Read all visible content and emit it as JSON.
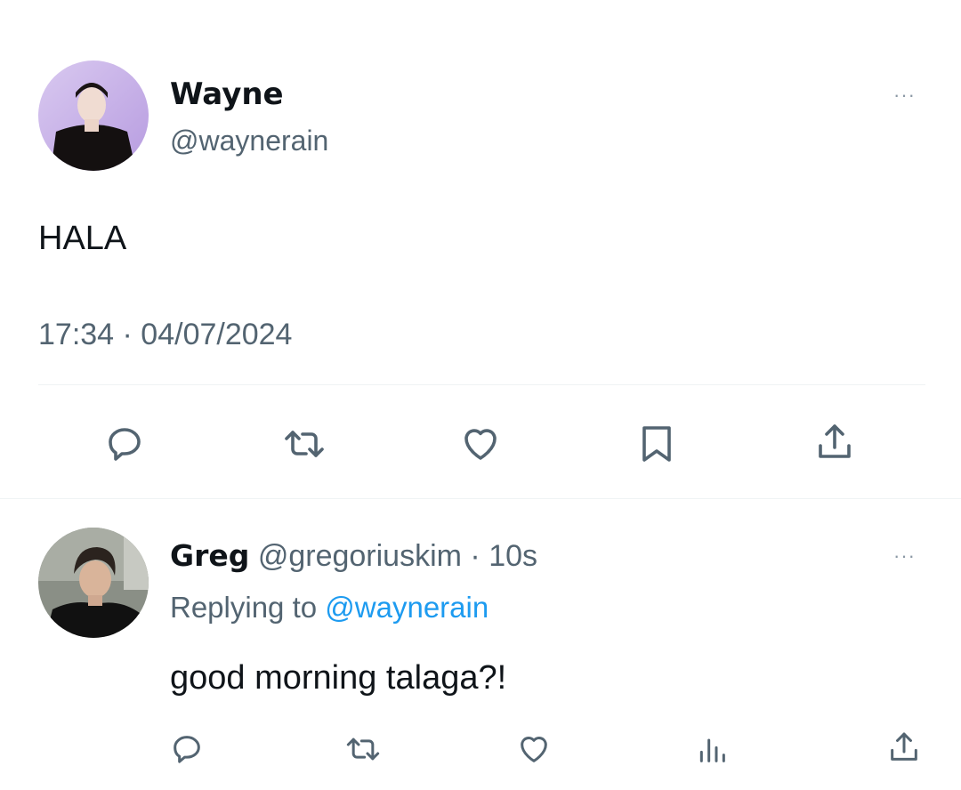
{
  "main_tweet": {
    "author": {
      "name": "Wayne",
      "handle": "@waynerain"
    },
    "text": "HALA",
    "timestamp": "17:34 · 04/07/2024",
    "more_label": "···",
    "actions": [
      "reply-icon",
      "retweet-icon",
      "like-icon",
      "bookmark-icon",
      "share-icon"
    ]
  },
  "reply": {
    "author": {
      "name": "Greg",
      "handle": "@gregoriuskim",
      "time": "· 10s"
    },
    "replying_to_label": "Replying to",
    "replying_to_handle": "@waynerain",
    "text": "good morning talaga?!",
    "more_label": "···",
    "actions": [
      "reply-icon",
      "retweet-icon",
      "like-icon",
      "views-icon",
      "share-icon"
    ]
  },
  "colors": {
    "text": "#0f1419",
    "secondary": "#536471",
    "link": "#1d9bf0",
    "divider": "#eff3f4"
  }
}
